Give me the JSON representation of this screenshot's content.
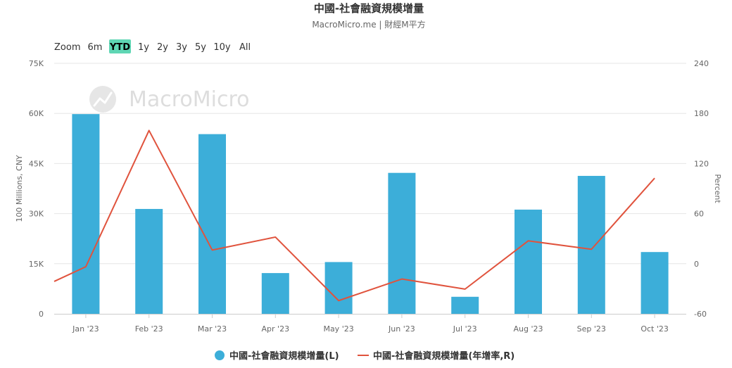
{
  "title": "中國-社會融資規模增量",
  "subtitle": "MacroMicro.me | 財經M平方",
  "watermark": "MacroMicro",
  "zoom": {
    "label": "Zoom",
    "buttons": [
      "6m",
      "YTD",
      "1y",
      "2y",
      "3y",
      "5y",
      "10y",
      "All"
    ],
    "active": "YTD"
  },
  "chart_data": {
    "type": "bar",
    "categories": [
      "Jan '23",
      "Feb '23",
      "Mar '23",
      "Apr '23",
      "May '23",
      "Jun '23",
      "Jul '23",
      "Aug '23",
      "Sep '23",
      "Oct '23"
    ],
    "series": [
      {
        "name": "中國-社會融資規模增量(L)",
        "type": "bar",
        "axis": "left",
        "values": [
          59800,
          31400,
          53800,
          12200,
          15500,
          42200,
          5100,
          31200,
          41300,
          18500
        ]
      },
      {
        "name": "中國-社會融資規模增量(年增率,R)",
        "type": "line",
        "axis": "right",
        "values": [
          -3.6,
          159.6,
          16.4,
          31.9,
          -44.2,
          -18.3,
          -30.4,
          27.4,
          17.3,
          102.5
        ],
        "start_value": -21.2
      }
    ],
    "ylabel": "100 Millions, CNY",
    "y2label": "Percent",
    "ylim": [
      0,
      75000
    ],
    "y2lim": [
      -60,
      240
    ],
    "yticks": [
      "0",
      "15K",
      "30K",
      "45K",
      "60K",
      "75K"
    ],
    "y2ticks": [
      "-60",
      "0",
      "60",
      "120",
      "180",
      "240"
    ],
    "grid": true,
    "legend": "bottom-center",
    "colors": {
      "bar": "#3caed9",
      "line": "#e0533d"
    }
  }
}
